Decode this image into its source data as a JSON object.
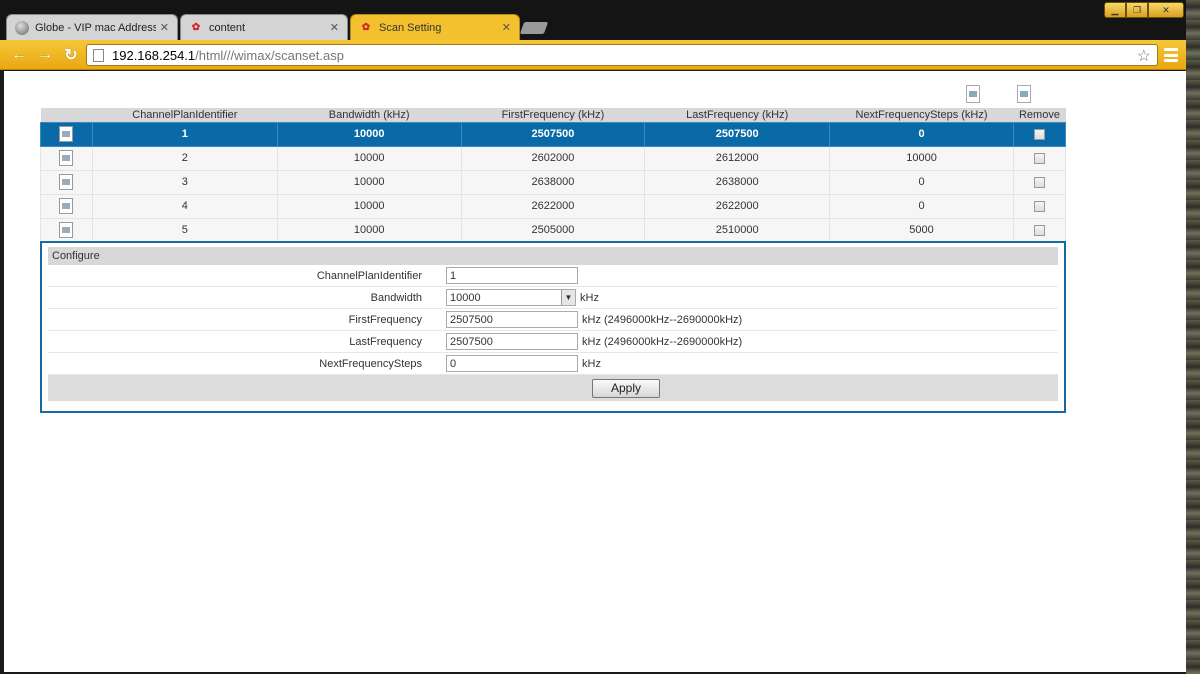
{
  "tabs": [
    {
      "label": "Globe - VIP mac Address f",
      "icon": "globe-icon"
    },
    {
      "label": "content",
      "icon": "huawei-icon"
    },
    {
      "label": "Scan Setting",
      "icon": "huawei-icon",
      "active": true
    }
  ],
  "address_bar": {
    "host": "192.168.254.1",
    "path": "/html///wimax/scanset.asp"
  },
  "table": {
    "columns": [
      "",
      "ChannelPlanIdentifier",
      "Bandwidth (kHz)",
      "FirstFrequency (kHz)",
      "LastFrequency (kHz)",
      "NextFrequencySteps (kHz)",
      "Remove"
    ],
    "rows": [
      {
        "id": "1",
        "bandwidth": "10000",
        "first": "2507500",
        "last": "2507500",
        "steps": "0",
        "selected": true
      },
      {
        "id": "2",
        "bandwidth": "10000",
        "first": "2602000",
        "last": "2612000",
        "steps": "10000"
      },
      {
        "id": "3",
        "bandwidth": "10000",
        "first": "2638000",
        "last": "2638000",
        "steps": "0"
      },
      {
        "id": "4",
        "bandwidth": "10000",
        "first": "2622000",
        "last": "2622000",
        "steps": "0"
      },
      {
        "id": "5",
        "bandwidth": "10000",
        "first": "2505000",
        "last": "2510000",
        "steps": "5000"
      }
    ]
  },
  "configure": {
    "title": "Configure",
    "fields": {
      "channel_plan": {
        "label": "ChannelPlanIdentifier",
        "value": "1"
      },
      "bandwidth": {
        "label": "Bandwidth",
        "value": "10000",
        "unit": "kHz"
      },
      "first_freq": {
        "label": "FirstFrequency",
        "value": "2507500",
        "unit": "kHz (2496000kHz--2690000kHz)"
      },
      "last_freq": {
        "label": "LastFrequency",
        "value": "2507500",
        "unit": "kHz (2496000kHz--2690000kHz)"
      },
      "next_steps": {
        "label": "NextFrequencySteps",
        "value": "0",
        "unit": "kHz"
      }
    },
    "apply_label": "Apply"
  },
  "colors": {
    "accent": "#0a6aa8",
    "toolbar": "#f3c12e"
  }
}
